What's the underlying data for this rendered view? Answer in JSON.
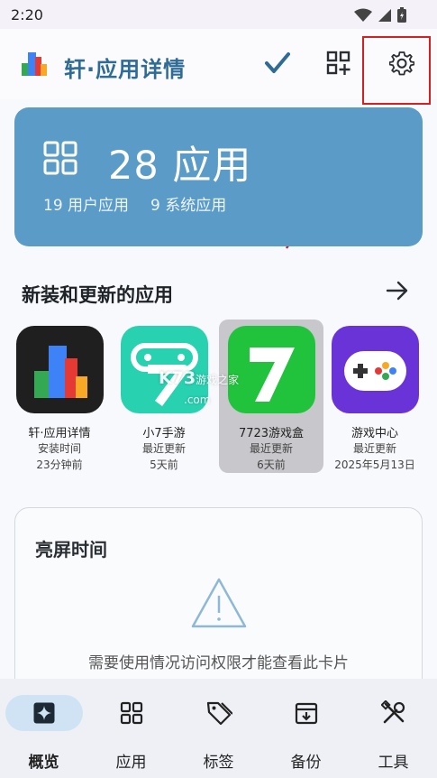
{
  "status": {
    "time": "2:20"
  },
  "appbar": {
    "title": "轩·应用详情"
  },
  "summary": {
    "count_text": "28 应用",
    "user_apps": "19 用户应用",
    "system_apps": "9 系统应用"
  },
  "recent": {
    "title": "新装和更新的应用",
    "apps": [
      {
        "name": "轩·应用详情",
        "status": "安装时间",
        "time": "23分钟前"
      },
      {
        "name": "小7手游",
        "status": "最近更新",
        "time": "5天前"
      },
      {
        "name": "7723游戏盒",
        "status": "最近更新",
        "time": "6天前"
      },
      {
        "name": "游戏中心",
        "status": "最近更新",
        "time": "2025年5月13日"
      }
    ]
  },
  "watermark": {
    "main": "K73",
    "sub": "游戏之家",
    "domain": ".com"
  },
  "screen_time": {
    "title": "亮屏时间",
    "message": "需要使用情况访问权限才能查看此卡片"
  },
  "nav": [
    {
      "label": "概览",
      "icon": "sparkle-icon",
      "active": true
    },
    {
      "label": "应用",
      "icon": "apps-grid-icon"
    },
    {
      "label": "标签",
      "icon": "tag-icon"
    },
    {
      "label": "备份",
      "icon": "archive-icon"
    },
    {
      "label": "工具",
      "icon": "tools-icon"
    }
  ],
  "colors": {
    "accent": "#2f6b95",
    "summary_card": "#5a9bc7",
    "highlight": "#d32020"
  }
}
